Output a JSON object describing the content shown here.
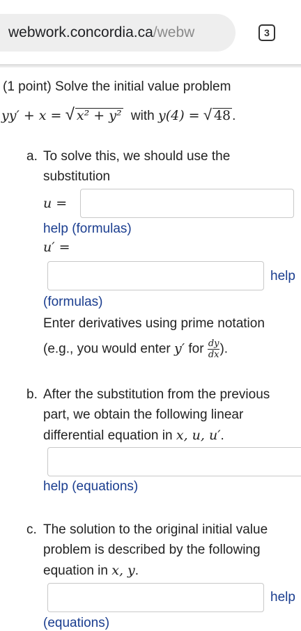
{
  "browser": {
    "url_host": "webwork.concordia.ca",
    "url_path": "/webw",
    "tab_count": "3"
  },
  "problem": {
    "points": "(1 point) Solve the initial value problem",
    "equation_lhs": "yy′ + x =",
    "sqrt_content": "x² + y²",
    "with_text": "with",
    "initial_condition": "y(4) =",
    "ic_sqrt": "48",
    "period": "."
  },
  "part_a": {
    "marker": "a.",
    "line1": "To solve this, we should use the",
    "line2": "substitution",
    "u_label": "u =",
    "u_value": "",
    "help1": "help (formulas)",
    "uprime_label": "u′ =",
    "uprime_value": "",
    "help2_a": "help",
    "help2_b": "(formulas)",
    "note1": "Enter derivatives using prime notation",
    "note2_pre": "(e.g., you would enter",
    "note2_y": "y′",
    "note2_for": "for",
    "frac_num": "dy",
    "frac_den": "dx",
    "note2_post": ")."
  },
  "part_b": {
    "marker": "b.",
    "line1": "After the substitution from the previous",
    "line2": "part, we obtain the following linear",
    "line3_pre": "differential equation in",
    "line3_vars": "x, u, u′",
    "line3_post": ".",
    "value": "",
    "help": "help (equations)"
  },
  "part_c": {
    "marker": "c.",
    "line1": "The solution to the original initial value",
    "line2": "problem is described by the following",
    "line3_pre": "equation in",
    "line3_vars": "x, y",
    "line3_post": ".",
    "value": "",
    "help_a": "help",
    "help_b": "(equations)"
  }
}
